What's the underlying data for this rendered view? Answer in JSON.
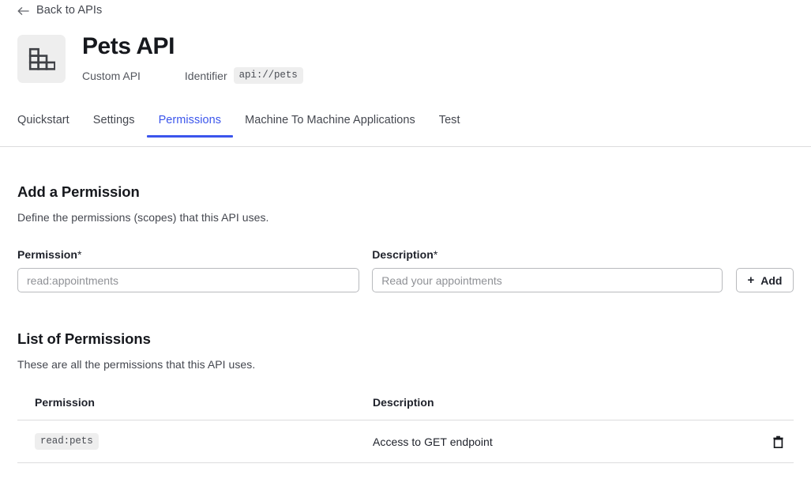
{
  "back": {
    "label": "Back to APIs",
    "icon": "arrow-left-icon"
  },
  "api": {
    "icon": "api-blocks-icon",
    "title": "Pets API",
    "type": "Custom API",
    "identifier_label": "Identifier",
    "identifier_value": "api://pets"
  },
  "tabs": [
    {
      "label": "Quickstart",
      "active": false
    },
    {
      "label": "Settings",
      "active": false
    },
    {
      "label": "Permissions",
      "active": true
    },
    {
      "label": "Machine To Machine Applications",
      "active": false
    },
    {
      "label": "Test",
      "active": false
    }
  ],
  "add_permission": {
    "title": "Add a Permission",
    "subtitle": "Define the permissions (scopes) that this API uses.",
    "permission_label": "Permission",
    "permission_required": "*",
    "permission_value": "",
    "permission_placeholder": "read:appointments",
    "description_label": "Description",
    "description_required": "*",
    "description_value": "",
    "description_placeholder": "Read your appointments",
    "add_button_label": "Add",
    "add_button_icon": "plus-icon"
  },
  "list_permissions": {
    "title": "List of Permissions",
    "subtitle": "These are all the permissions that this API uses.",
    "columns": [
      "Permission",
      "Description"
    ],
    "rows": [
      {
        "permission": "read:pets",
        "description": "Access to GET endpoint",
        "delete_icon": "trash-icon"
      }
    ]
  },
  "colors": {
    "accent": "#3b55ec",
    "text": "#1e212a",
    "muted": "#53565d",
    "border": "#dcdcdd",
    "chip_bg": "#eeeeee"
  }
}
